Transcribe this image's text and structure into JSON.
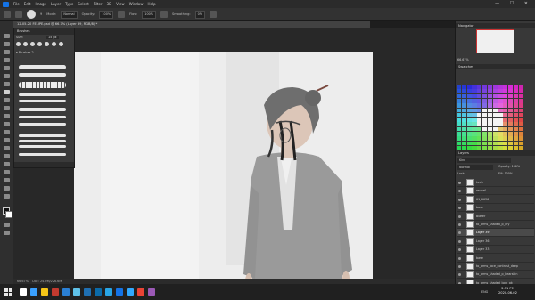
{
  "menubar": {
    "items": [
      "File",
      "Edit",
      "Image",
      "Layer",
      "Type",
      "Select",
      "Filter",
      "3D",
      "View",
      "Window",
      "Help"
    ],
    "window_controls": "— ☐ ✕"
  },
  "options_bar": {
    "size_value": "9",
    "mode_label": "Mode:",
    "mode_value": "Normal",
    "opacity_label": "Opacity:",
    "opacity_value": "100%",
    "flow_label": "Flow:",
    "flow_value": "100%",
    "smoothing_label": "Smoothing:",
    "smoothing_value": "0%"
  },
  "document_tab": {
    "title": "12-05-20 FELIPE.psd @ 66.7% (Layer 39, RGB/8) *"
  },
  "brushes_panel": {
    "title": "Brushes",
    "size_label": "Size:",
    "size_value": "15 px",
    "folder_label": "Brushes 2"
  },
  "status_bar": {
    "zoom": "66.67%",
    "doc": "Doc: 24.9M/226.6M"
  },
  "right_panels": {
    "navigator_title": "Navigator",
    "navigator_zoom": "66.67%",
    "swatches_title": "Swatches",
    "layers_title": "Layers",
    "kind_label": "Kind",
    "blend_mode": "Normal",
    "opacity": "Opacity: 100%",
    "fill": "Fill: 100%",
    "lock": "Lock:"
  },
  "layers": [
    {
      "name": "kech"
    },
    {
      "name": "rec ref"
    },
    {
      "name": "01_0036"
    },
    {
      "name": "base"
    },
    {
      "name": "Blazer"
    },
    {
      "name": "to_arms_shaded_p_cry"
    },
    {
      "name": "Layer 39"
    },
    {
      "name": "Layer 36"
    },
    {
      "name": "Layer 33"
    },
    {
      "name": "base"
    },
    {
      "name": "to_arms_face_contrast_deep"
    },
    {
      "name": "to_arms_shaded_p_bearskin"
    },
    {
      "name": "to_arms_shaded_lock_ok"
    }
  ],
  "taskbar": {
    "language": "ENG",
    "time": "2:51 PM",
    "date": "2020-06-02",
    "icon_colors": [
      "#ffffff",
      "#3aa0ff",
      "#f5c518",
      "#c33a2f",
      "#2a7fd4",
      "#5fc1e8",
      "#1f6fb2",
      "#0b6aa8",
      "#29a5e6",
      "#1473e6",
      "#31a8ff",
      "#ea4335",
      "#9b59b6"
    ]
  }
}
